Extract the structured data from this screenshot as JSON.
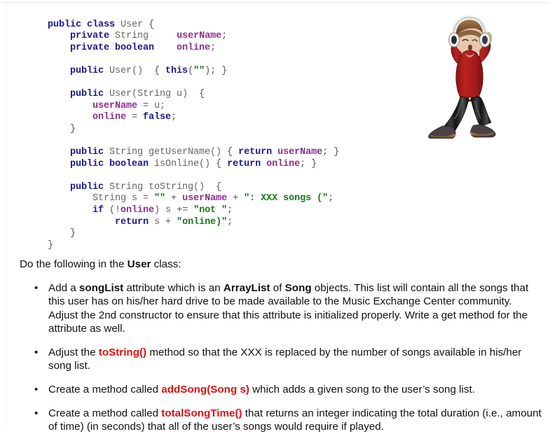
{
  "code": {
    "language": "java",
    "lines": [
      [
        {
          "t": "public class ",
          "c": "kw"
        },
        {
          "t": "User",
          "c": "typ"
        },
        {
          "t": " {",
          "c": "pnc"
        }
      ],
      [
        {
          "t": "    private ",
          "c": "kw"
        },
        {
          "t": "String",
          "c": "typ"
        },
        {
          "t": "     ",
          "c": "pln"
        },
        {
          "t": "userName",
          "c": "id"
        },
        {
          "t": ";",
          "c": "pnc"
        }
      ],
      [
        {
          "t": "    private boolean",
          "c": "kw"
        },
        {
          "t": "    ",
          "c": "pln"
        },
        {
          "t": "online",
          "c": "id"
        },
        {
          "t": ";",
          "c": "pnc"
        }
      ],
      [],
      [
        {
          "t": "    public ",
          "c": "kw"
        },
        {
          "t": "User()",
          "c": "typ"
        },
        {
          "t": "  { ",
          "c": "pnc"
        },
        {
          "t": "this",
          "c": "kw"
        },
        {
          "t": "(",
          "c": "pnc"
        },
        {
          "t": "\"\"",
          "c": "str"
        },
        {
          "t": "); }",
          "c": "pnc"
        }
      ],
      [],
      [
        {
          "t": "    public ",
          "c": "kw"
        },
        {
          "t": "User(String u)",
          "c": "typ"
        },
        {
          "t": "  {",
          "c": "pnc"
        }
      ],
      [
        {
          "t": "        ",
          "c": "pln"
        },
        {
          "t": "userName",
          "c": "id"
        },
        {
          "t": " = ",
          "c": "pnc"
        },
        {
          "t": "u;",
          "c": "typ"
        }
      ],
      [
        {
          "t": "        ",
          "c": "pln"
        },
        {
          "t": "online",
          "c": "id"
        },
        {
          "t": " = ",
          "c": "pnc"
        },
        {
          "t": "false",
          "c": "kw"
        },
        {
          "t": ";",
          "c": "pnc"
        }
      ],
      [
        {
          "t": "    }",
          "c": "pnc"
        }
      ],
      [],
      [
        {
          "t": "    public ",
          "c": "kw"
        },
        {
          "t": "String getUserName()",
          "c": "typ"
        },
        {
          "t": " { ",
          "c": "pnc"
        },
        {
          "t": "return ",
          "c": "kw"
        },
        {
          "t": "userName",
          "c": "id"
        },
        {
          "t": "; }",
          "c": "pnc"
        }
      ],
      [
        {
          "t": "    public boolean ",
          "c": "kw"
        },
        {
          "t": "isOnline()",
          "c": "typ"
        },
        {
          "t": " { ",
          "c": "pnc"
        },
        {
          "t": "return ",
          "c": "kw"
        },
        {
          "t": "online",
          "c": "id"
        },
        {
          "t": "; }",
          "c": "pnc"
        }
      ],
      [],
      [
        {
          "t": "    public ",
          "c": "kw"
        },
        {
          "t": "String toString()",
          "c": "typ"
        },
        {
          "t": "  {",
          "c": "pnc"
        }
      ],
      [
        {
          "t": "        String s = ",
          "c": "typ"
        },
        {
          "t": "\"\"",
          "c": "str"
        },
        {
          "t": " + ",
          "c": "pnc"
        },
        {
          "t": "userName",
          "c": "id"
        },
        {
          "t": " + ",
          "c": "pnc"
        },
        {
          "t": "\": XXX songs (\"",
          "c": "str"
        },
        {
          "t": ";",
          "c": "pnc"
        }
      ],
      [
        {
          "t": "        if ",
          "c": "kw"
        },
        {
          "t": "(!",
          "c": "pnc"
        },
        {
          "t": "online",
          "c": "id"
        },
        {
          "t": ") ",
          "c": "pnc"
        },
        {
          "t": "s",
          "c": "typ"
        },
        {
          "t": " += ",
          "c": "pnc"
        },
        {
          "t": "\"not \"",
          "c": "str"
        },
        {
          "t": ";",
          "c": "pnc"
        }
      ],
      [
        {
          "t": "            return ",
          "c": "kw"
        },
        {
          "t": "s",
          "c": "typ"
        },
        {
          "t": " + ",
          "c": "pnc"
        },
        {
          "t": "\"online)\"",
          "c": "str"
        },
        {
          "t": ";",
          "c": "pnc"
        }
      ],
      [
        {
          "t": "    }",
          "c": "pnc"
        }
      ],
      [
        {
          "t": "}",
          "c": "pnc"
        }
      ]
    ]
  },
  "illustration": {
    "name": "dancing-boy-with-headphones",
    "alt": "Cartoon boy dancing while wearing headphones",
    "colors": {
      "shirt": "#b01c1c",
      "shirt_shadow": "#8a1414",
      "pants": "#141414",
      "pants_highlight": "#4a4a4a",
      "shoes": "#3a3235",
      "shoe_sole": "#c8a060",
      "skin": "#e3c2a8",
      "hair": "#8a6038",
      "headphones": "#f2f2f2",
      "headphones_dark": "#1f1f1f"
    }
  },
  "prose": {
    "lead_prefix": "Do the following in the ",
    "lead_bold": "User",
    "lead_suffix": " class:",
    "bullet_glyph": "•",
    "items": [
      {
        "id": "songlist-attribute",
        "parts": [
          {
            "t": "Add a ",
            "s": "plain"
          },
          {
            "t": "songList",
            "s": "bold"
          },
          {
            "t": " attribute which is an ",
            "s": "plain"
          },
          {
            "t": "ArrayList",
            "s": "bold"
          },
          {
            "t": " of ",
            "s": "plain"
          },
          {
            "t": "Song",
            "s": "bold"
          },
          {
            "t": " objects.  This list will contain all the songs that this user has on his/her hard drive to be made available to the Music Exchange Center community.  Adjust the 2nd constructor to ensure that this attribute is initialized properly.  Write a get method for the attribute as well.",
            "s": "plain"
          }
        ]
      },
      {
        "id": "adjust-tostring",
        "parts": [
          {
            "t": "Adjust the ",
            "s": "plain"
          },
          {
            "t": "toString()",
            "s": "red"
          },
          {
            "t": " method so that the XXX is replaced by the number of songs available in his/her song list.",
            "s": "plain"
          }
        ]
      },
      {
        "id": "add-song-method",
        "parts": [
          {
            "t": "Create a method called ",
            "s": "plain"
          },
          {
            "t": "addSong(Song s)",
            "s": "red"
          },
          {
            "t": " which adds a given song to the user’s song list.",
            "s": "plain"
          }
        ]
      },
      {
        "id": "total-song-time-method",
        "parts": [
          {
            "t": "Create a method called ",
            "s": "plain"
          },
          {
            "t": "totalSongTime()",
            "s": "red"
          },
          {
            "t": " that returns an integer indicating the total duration (i.e., amount of time) (in seconds) that all of the user’s songs would require if played.",
            "s": "plain"
          }
        ]
      }
    ]
  },
  "colors": {
    "keyword": "#1a1a8c",
    "type": "#666666",
    "identifier": "#8e2f8e",
    "string": "#1a7a1a",
    "accent_red": "#e01010",
    "page_background": "#ffffff",
    "body_text": "#111111"
  }
}
